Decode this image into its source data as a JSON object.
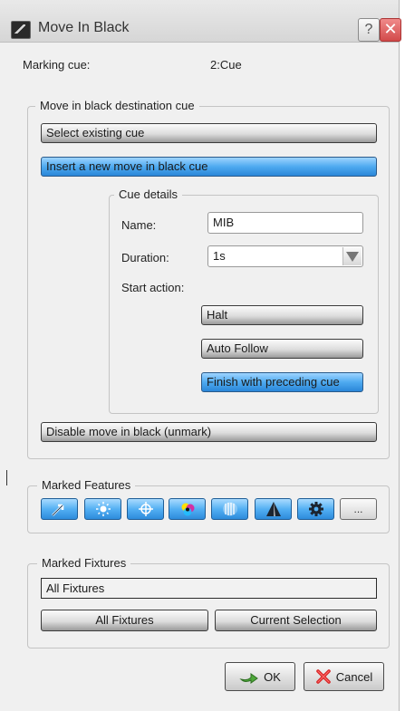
{
  "window": {
    "title": "Move In Black",
    "help_glyph": "?",
    "close_glyph": "✕"
  },
  "marking_cue": {
    "label": "Marking cue:",
    "value": "2:Cue"
  },
  "destination": {
    "legend": "Move in black destination cue",
    "options": [
      "Select existing cue",
      "Insert a new move in black cue"
    ],
    "selected": "Insert a new move in black cue"
  },
  "cue_details": {
    "legend": "Cue details",
    "name_label": "Name:",
    "name_value": "MIB",
    "duration_label": "Duration:",
    "duration_value": "1s",
    "start_action_label": "Start action:",
    "start_actions": [
      "Halt",
      "Auto Follow",
      "Finish with preceding cue"
    ],
    "selected_action": "Finish with preceding cue"
  },
  "disable_button": "Disable move in black (unmark)",
  "marked_features": {
    "legend": "Marked Features",
    "icons": [
      "position-icon",
      "intensity-icon",
      "focus-icon",
      "colour-icon",
      "beam-icon",
      "shape-icon",
      "gobo-icon",
      "more-icon"
    ],
    "more_label": "..."
  },
  "marked_fixtures": {
    "legend": "Marked Fixtures",
    "field_value": "All Fixtures",
    "all_button": "All Fixtures",
    "current_button": "Current Selection"
  },
  "footer": {
    "ok_label": "OK",
    "cancel_label": "Cancel"
  },
  "colors": {
    "selected_blue": "#4eaaf0",
    "dialog_bg": "#f0f0f0",
    "close_red": "#d24a4a"
  }
}
